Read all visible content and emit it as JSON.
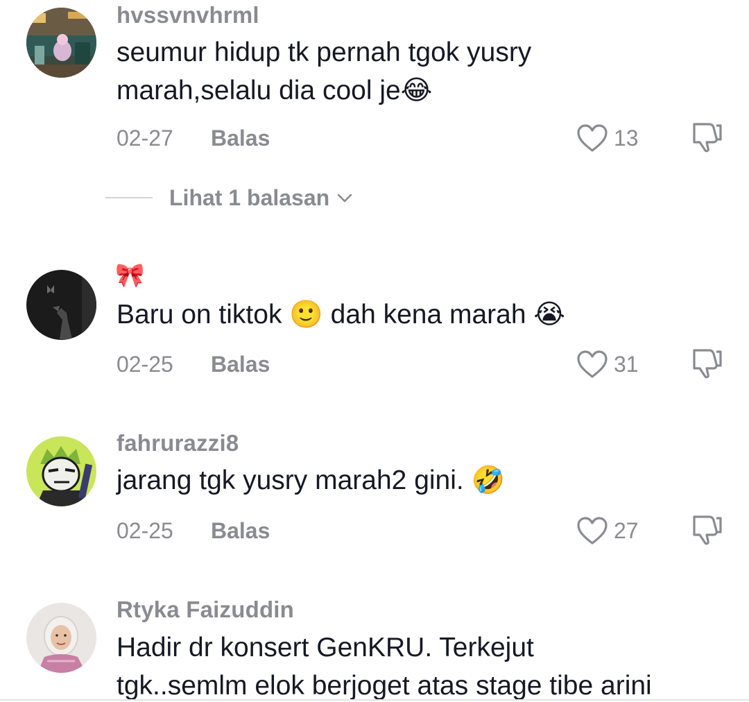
{
  "comments": [
    {
      "username": "hvssvnvhrml",
      "text_line1": "seumur hidup tk pernah tgok yusry",
      "text_line2": "marah,selalu dia cool je😂",
      "date": "02-27",
      "reply_label": "Balas",
      "likes": "13",
      "view_replies": "Lihat 1 balasan"
    },
    {
      "username_emoji": "🎀",
      "text_line1": "Baru on tiktok 🙂 dah kena marah 😭",
      "date": "02-25",
      "reply_label": "Balas",
      "likes": "31"
    },
    {
      "username": "fahrurazzi8",
      "text_line1": "jarang tgk yusry marah2 gini. 🤣",
      "date": "02-25",
      "reply_label": "Balas",
      "likes": "27"
    },
    {
      "username": "Rtyka Faizuddin",
      "text_line1": "Hadir dr konsert GenKRU. Terkejut",
      "text_line2": "tgk..semlm elok berjoget atas stage tibe arini"
    }
  ],
  "icons": {
    "like": "heart-outline-icon",
    "dislike": "thumbs-down-icon",
    "expand": "chevron-down-icon"
  },
  "colors": {
    "text": "#161823",
    "muted": "#8a8b91",
    "bow": "#f5a3c0"
  }
}
